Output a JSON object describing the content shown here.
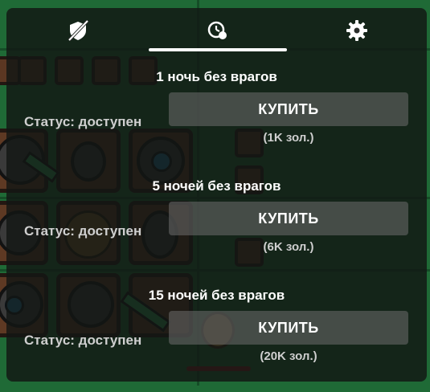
{
  "tabs": [
    {
      "id": "no-enemies",
      "icon": "crossed-shield-icon",
      "active": false
    },
    {
      "id": "time-offers",
      "icon": "clock-badge-icon",
      "active": true
    },
    {
      "id": "settings",
      "icon": "gear-icon",
      "active": false
    }
  ],
  "offers": [
    {
      "title": "1 ночь без врагов",
      "status": "Статус: доступен",
      "button": "КУПИТЬ",
      "price": "(1K зол.)"
    },
    {
      "title": "5 ночей без врагов",
      "status": "Статус: доступен",
      "button": "КУПИТЬ",
      "price": "(6K зол.)"
    },
    {
      "title": "15 ночей без врагов",
      "status": "Статус: доступен",
      "button": "КУПИТЬ",
      "price": "(20K зол.)"
    }
  ],
  "colors": {
    "panel": "#121614",
    "button": "#6e6e6e",
    "grass": "#1f6a36"
  }
}
